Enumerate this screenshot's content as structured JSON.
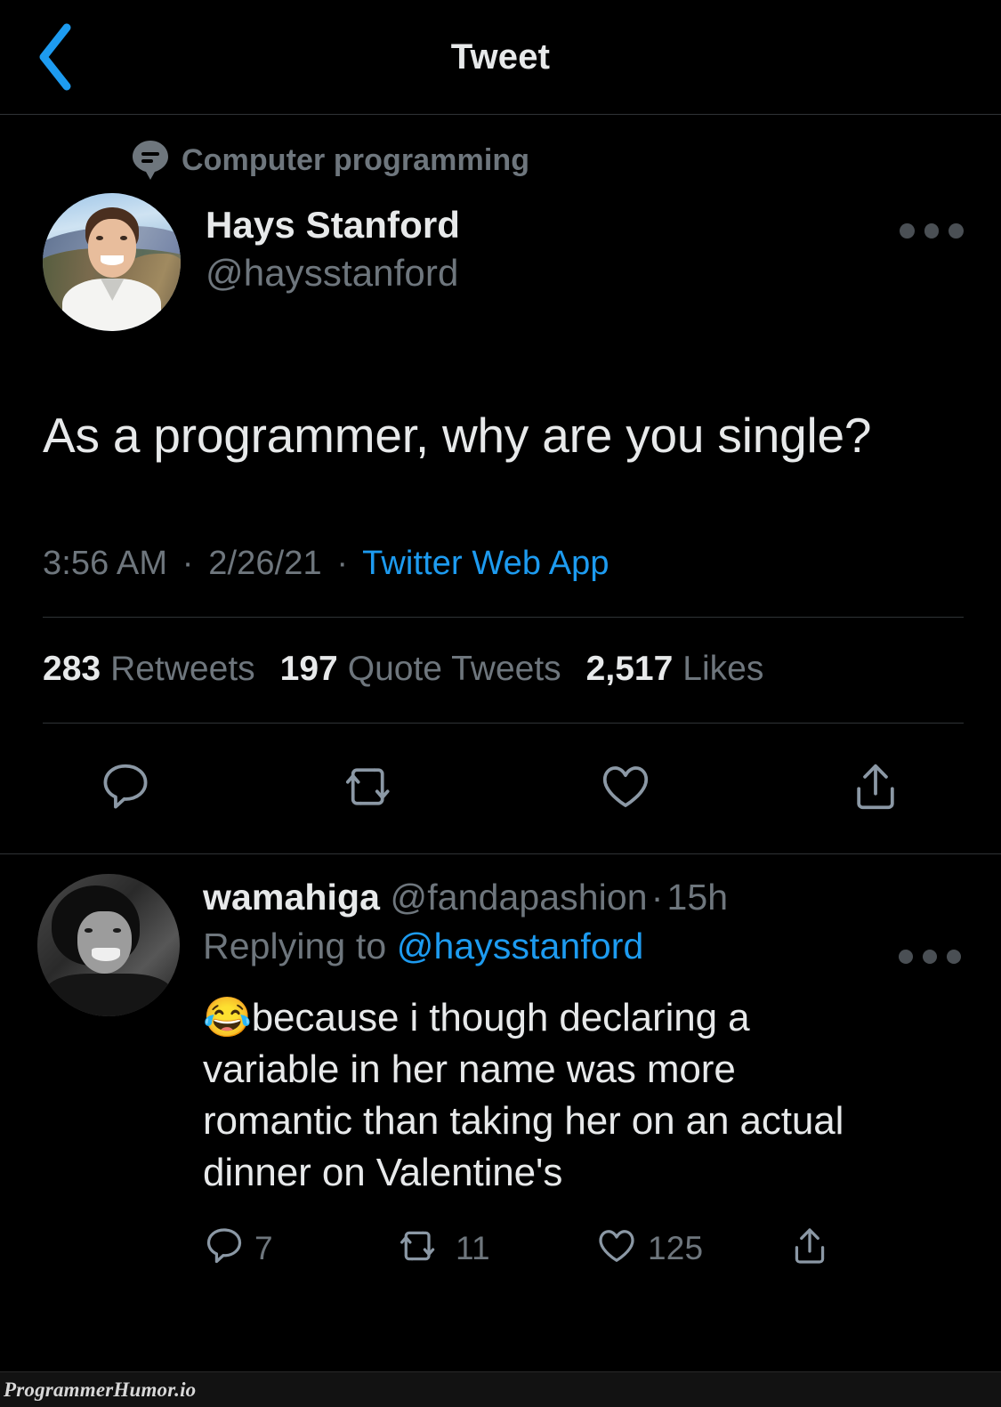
{
  "colors": {
    "background": "#000000",
    "text_primary": "#e7e9ea",
    "text_secondary": "#6e767d",
    "accent_blue": "#1d9bf0",
    "divider": "#2f3336",
    "watermark_bar": "#121212"
  },
  "header": {
    "back_icon": "chevron-left-icon",
    "title": "Tweet"
  },
  "tweet": {
    "topic": {
      "icon": "topic-bubble-icon",
      "label": "Computer programming"
    },
    "author": {
      "avatar": "avatar-hays-stanford",
      "display_name": "Hays Stanford",
      "handle": "@haysstanford",
      "more_icon": "more-horizontal-icon"
    },
    "body": "As a programmer, why are you single?",
    "meta": {
      "time": "3:56 AM",
      "separator_1": "·",
      "date": "2/26/21",
      "separator_2": "·",
      "client": "Twitter Web App"
    },
    "stats": [
      {
        "count": "283",
        "label": "Retweets"
      },
      {
        "count": "197",
        "label": "Quote Tweets"
      },
      {
        "count": "2,517",
        "label": "Likes"
      }
    ],
    "actions": [
      {
        "icon": "reply-icon",
        "label": "Reply"
      },
      {
        "icon": "retweet-icon",
        "label": "Retweet"
      },
      {
        "icon": "like-heart-icon",
        "label": "Like"
      },
      {
        "icon": "share-icon",
        "label": "Share"
      }
    ]
  },
  "reply": {
    "avatar": "avatar-wamahiga",
    "display_name": "wamahiga",
    "handle": "@fandapashion",
    "dot": "·",
    "timestamp": "15h",
    "replying_to_prefix": "Replying to ",
    "replying_to_mention": "@haysstanford",
    "emoji": "😂",
    "body": "because i though declaring a variable in her name was more romantic than taking her on an actual dinner on Valentine's",
    "more_icon": "more-horizontal-icon",
    "actions": [
      {
        "icon": "reply-icon",
        "count": "7",
        "label": "Reply"
      },
      {
        "icon": "retweet-icon",
        "count": "11",
        "label": "Retweet"
      },
      {
        "icon": "like-heart-icon",
        "count": "125",
        "label": "Like"
      },
      {
        "icon": "share-icon",
        "count": "",
        "label": "Share"
      }
    ]
  },
  "watermark": {
    "text": "ProgrammerHumor.io"
  }
}
